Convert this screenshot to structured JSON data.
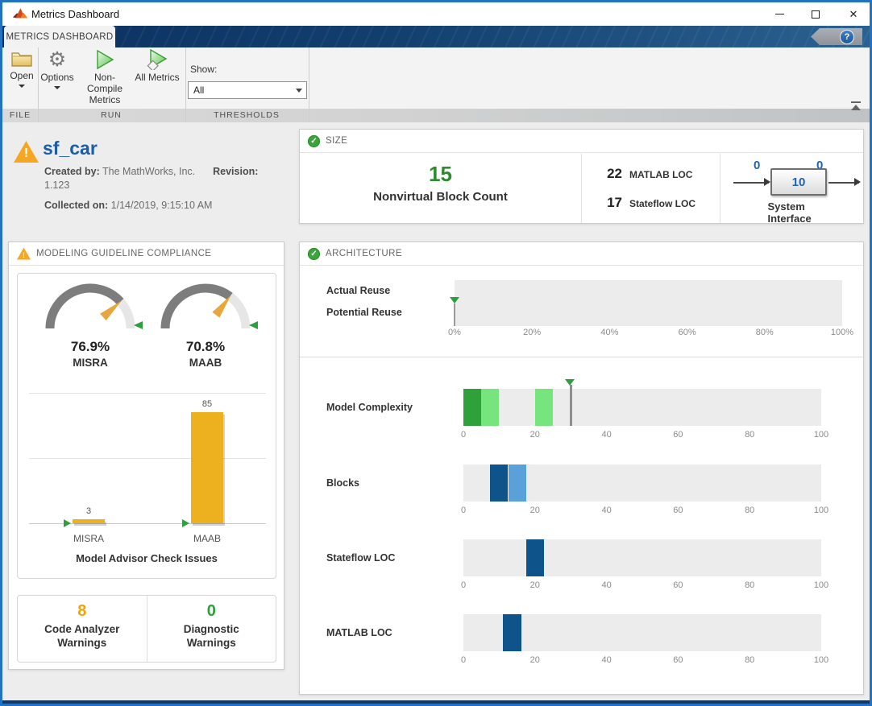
{
  "window": {
    "title": "Metrics Dashboard"
  },
  "tab_strip": {
    "tab_label": "METRICS DASHBOARD"
  },
  "icons": {
    "help_glyph": "?",
    "check_glyph": "✓",
    "warning_glyph": "!",
    "gear_glyph": "⚙",
    "close_glyph": "✕"
  },
  "toolbar": {
    "open_label": "Open",
    "options_label": "Options",
    "non_compile_label": "Non-Compile Metrics",
    "all_metrics_label": "All Metrics",
    "show_label": "Show:",
    "show_value": "All",
    "file_section_label": "FILE",
    "run_section_label": "RUN",
    "thresholds_section_label": "THRESHOLDS"
  },
  "model_info": {
    "name": "sf_car",
    "created_by_label": "Created by:",
    "created_by": "The MathWorks, Inc.",
    "revision_label": "Revision:",
    "revision": "1.123",
    "collected_label": "Collected on:",
    "collected": "1/14/2019, 9:15:10 AM"
  },
  "size_panel": {
    "title": "SIZE",
    "block_count": "15",
    "block_count_label": "Nonvirtual Block Count",
    "matlab_loc": "22",
    "matlab_loc_label": "MATLAB LOC",
    "stateflow_loc": "17",
    "stateflow_loc_label": "Stateflow LOC",
    "interface": {
      "in_count": "0",
      "out_count": "0",
      "center_count": "10",
      "label": "System Interface"
    }
  },
  "compliance_panel": {
    "title": "MODELING GUIDELINE COMPLIANCE",
    "gauges": [
      {
        "value_label": "76.9%",
        "label": "MISRA",
        "percent": 76.9
      },
      {
        "value_label": "70.8%",
        "label": "MAAB",
        "percent": 70.8
      }
    ],
    "issues_chart": {
      "type": "bar",
      "title": "Model Advisor Check Issues",
      "categories": [
        "MISRA",
        "MAAB"
      ],
      "values": [
        3,
        85
      ],
      "ymax": 105,
      "gridlines": [
        50,
        100
      ],
      "thresholds": [
        0,
        0
      ]
    },
    "warnings": [
      {
        "value": "8",
        "label": "Code Analyzer Warnings",
        "color": "#F5A300"
      },
      {
        "value": "0",
        "label": "Diagnostic Warnings",
        "color": "#2E9E3E"
      }
    ]
  },
  "architecture_panel": {
    "title": "ARCHITECTURE",
    "reuse": {
      "labels": [
        "Actual Reuse",
        "Potential Reuse"
      ],
      "ticks": [
        "0%",
        "20%",
        "40%",
        "60%",
        "80%",
        "100%"
      ],
      "marker_value": 0
    },
    "metrics": [
      {
        "label": "Model Complexity",
        "threshold": 30,
        "segments": [
          {
            "from": 0,
            "to": 5,
            "color": "#2EA13B"
          },
          {
            "from": 5,
            "to": 10,
            "color": "#77E57E"
          },
          {
            "from": 20,
            "to": 25,
            "color": "#77E57E"
          }
        ],
        "ticks": [
          "0",
          "20",
          "40",
          "60",
          "80",
          "100"
        ]
      },
      {
        "label": "Blocks",
        "segments": [
          {
            "from": 7.5,
            "to": 12.5,
            "color": "#0F538B"
          },
          {
            "from": 12.5,
            "to": 17.5,
            "color": "#5BA1D9"
          }
        ],
        "ticks": [
          "0",
          "20",
          "40",
          "60",
          "80",
          "100"
        ]
      },
      {
        "label": "Stateflow LOC",
        "segments": [
          {
            "from": 17.5,
            "to": 22.5,
            "color": "#0F538B"
          }
        ],
        "ticks": [
          "0",
          "20",
          "40",
          "60",
          "80",
          "100"
        ]
      },
      {
        "label": "MATLAB LOC",
        "segments": [
          {
            "from": 11,
            "to": 16.2,
            "color": "#0F538B"
          }
        ],
        "ticks": [
          "0",
          "20",
          "40",
          "60",
          "80",
          "100"
        ]
      }
    ]
  },
  "colors": {
    "accent_blue": "#2173C2",
    "title_blue": "#1A5DAB",
    "good_green": "#2E8B2E",
    "bar_yellow": "#EDB120",
    "needle_orange": "#E9A63C",
    "marker_green": "#2F9E3F",
    "gauge_dark": "#7D7D7D",
    "gauge_light": "#E6E6E6",
    "interface_blue": "#1F63B0"
  }
}
